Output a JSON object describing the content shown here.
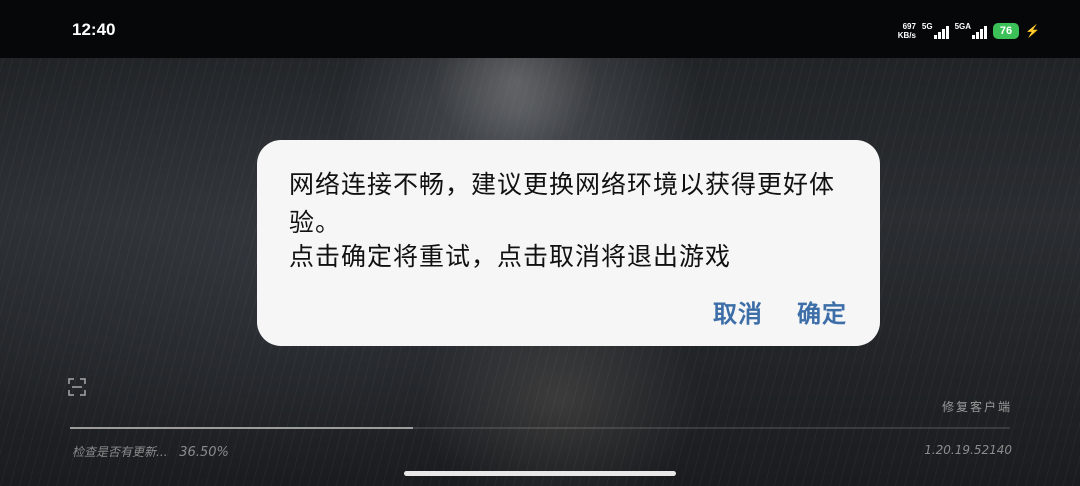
{
  "status_bar": {
    "time": "12:40",
    "net_speed_value": "697",
    "net_speed_unit": "KB/s",
    "network1": "5G",
    "network2": "5GA",
    "battery": "76"
  },
  "dialog": {
    "message_line1": "网络连接不畅，建议更换网络环境以获得更好体验。",
    "message_line2": "点击确定将重试，点击取消将退出游戏",
    "cancel_label": "取消",
    "confirm_label": "确定"
  },
  "launcher": {
    "repair_label": "修复客户端",
    "status_text": "检查是否有更新...",
    "progress_percent": "36.50%",
    "progress": 0.365,
    "version": "1.20.19.52140"
  },
  "icons": {
    "scan": "scan-icon",
    "charging": "charging-bolt-icon",
    "signal": "signal-icon"
  },
  "colors": {
    "battery": "#3cc158",
    "dialog_button": "#3d6ea8",
    "dialog_bg": "#f6f6f7"
  }
}
